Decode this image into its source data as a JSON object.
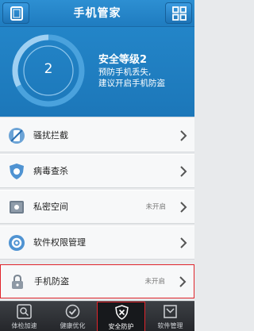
{
  "header": {
    "title": "手机管家"
  },
  "hero": {
    "level_number": "2",
    "level_title": "安全等级2",
    "hint_line1": "预防手机丢失,",
    "hint_line2": "建议开启手机防盗"
  },
  "menu": [
    {
      "label": "骚扰拦截",
      "status": "",
      "icon": "phone-block-icon"
    },
    {
      "label": "病毒查杀",
      "status": "",
      "icon": "shield-icon"
    },
    {
      "label": "私密空间",
      "status": "未开启",
      "icon": "safe-box-icon"
    },
    {
      "label": "软件权限管理",
      "status": "",
      "icon": "gear-icon"
    },
    {
      "label": "手机防盗",
      "status": "未开启",
      "icon": "lock-icon"
    }
  ],
  "bottom_nav": [
    {
      "label": "体检加速",
      "icon": "magnify-scan-icon"
    },
    {
      "label": "健康优化",
      "icon": "check-circle-icon"
    },
    {
      "label": "安全防护",
      "icon": "shield-x-icon"
    },
    {
      "label": "软件管理",
      "icon": "inbox-icon"
    }
  ],
  "colors": {
    "accent": "#1f7cc0",
    "highlight": "#e0242b"
  }
}
